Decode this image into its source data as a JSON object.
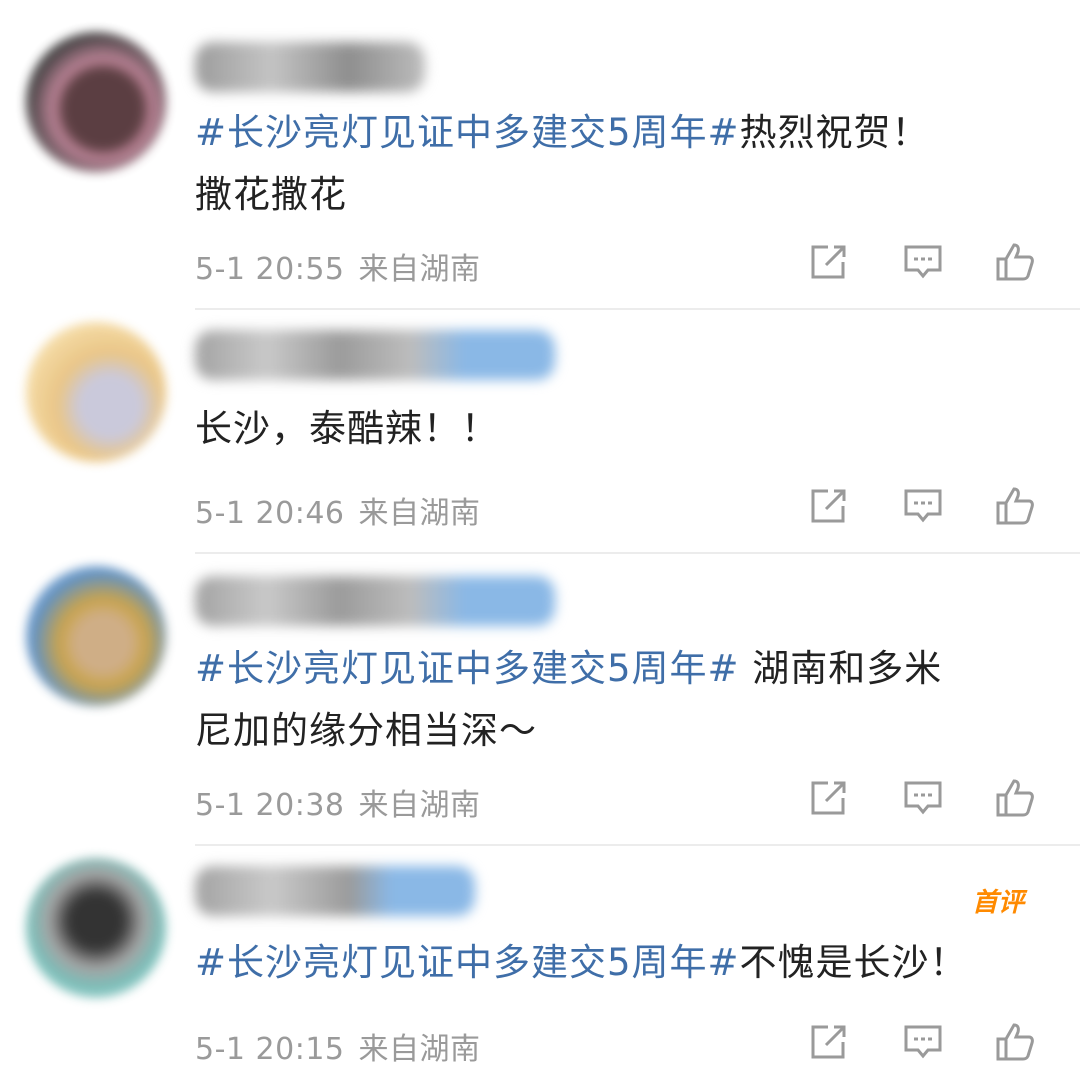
{
  "comments": [
    {
      "topic": "#长沙亮灯见证中多建交5周年#",
      "text": "热烈祝贺！",
      "line2": "撒花撒花",
      "time": "5-1 20:55",
      "location": "来自湖南"
    },
    {
      "topic": "",
      "text": "长沙，泰酷辣！！",
      "line2": "",
      "time": "5-1 20:46",
      "location": "来自湖南"
    },
    {
      "topic": "#长沙亮灯见证中多建交5周年#",
      "text": " 湖南和多米",
      "line2": "尼加的缘分相当深～",
      "time": "5-1 20:38",
      "location": "来自湖南"
    },
    {
      "topic": "#长沙亮灯见证中多建交5周年#",
      "text": "不愧是长沙！",
      "line2": "",
      "time": "5-1 20:15",
      "location": "来自湖南",
      "badge": "首评"
    }
  ],
  "icons": {
    "share": "share-icon",
    "comment": "comment-icon",
    "like": "like-icon"
  },
  "colors": {
    "topic": "#3f6ea8",
    "meta": "#9a9a9a",
    "badge": "#ff8a00"
  }
}
